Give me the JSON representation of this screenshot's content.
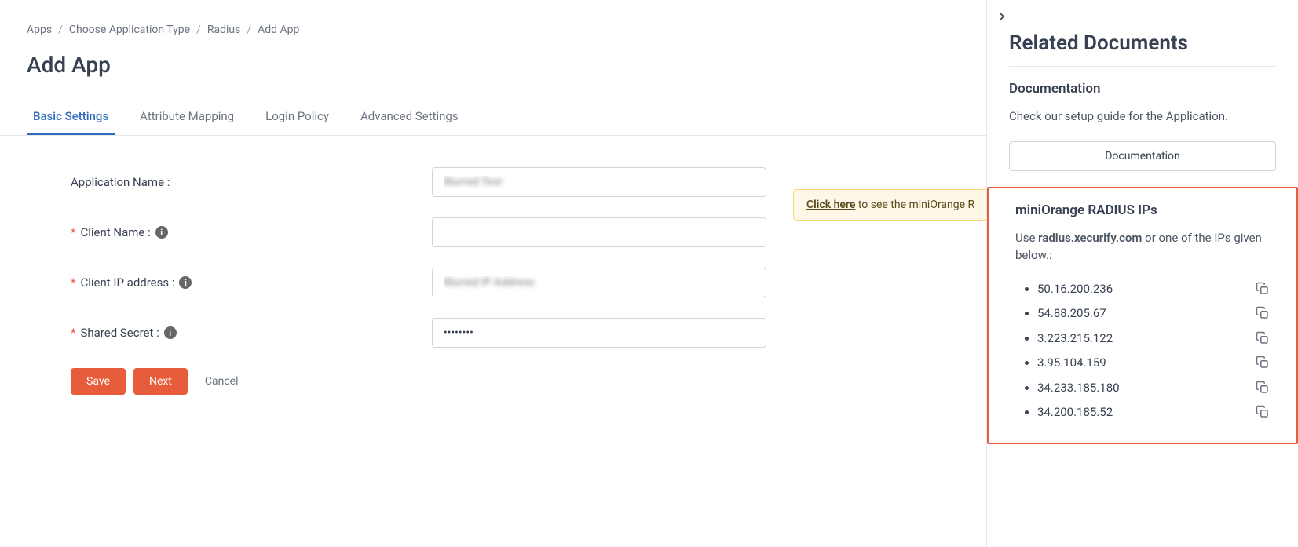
{
  "breadcrumb": {
    "items": [
      "Apps",
      "Choose Application Type",
      "Radius"
    ],
    "current": "Add App"
  },
  "page_title": "Add App",
  "tabs": [
    {
      "label": "Basic Settings",
      "active": true
    },
    {
      "label": "Attribute Mapping",
      "active": false
    },
    {
      "label": "Login Policy",
      "active": false
    },
    {
      "label": "Advanced Settings",
      "active": false
    }
  ],
  "form": {
    "app_name_label": "Application Name :",
    "app_name_value": "Blurred Text",
    "client_name_label": "Client Name :",
    "client_name_value": "",
    "client_ip_label": "Client IP address :",
    "client_ip_value": "Blurred IP Address",
    "shared_secret_label": "Shared Secret :",
    "shared_secret_value": "••••••••"
  },
  "alert": {
    "link_text": "Click here",
    "rest_text": " to see the miniOrange R"
  },
  "buttons": {
    "save": "Save",
    "next": "Next",
    "cancel": "Cancel"
  },
  "panel": {
    "title": "Related Documents",
    "doc_heading": "Documentation",
    "doc_text": "Check our setup guide for the Application.",
    "doc_button": "Documentation",
    "ips_heading": "miniOrange RADIUS IPs",
    "use_text": "Use ",
    "hostname": "radius.xecurify.com",
    "or_text": " or one of the IPs given below.:",
    "ips": [
      "50.16.200.236",
      "54.88.205.67",
      "3.223.215.122",
      "3.95.104.159",
      "34.233.185.180",
      "34.200.185.52"
    ]
  },
  "chart_data": null
}
